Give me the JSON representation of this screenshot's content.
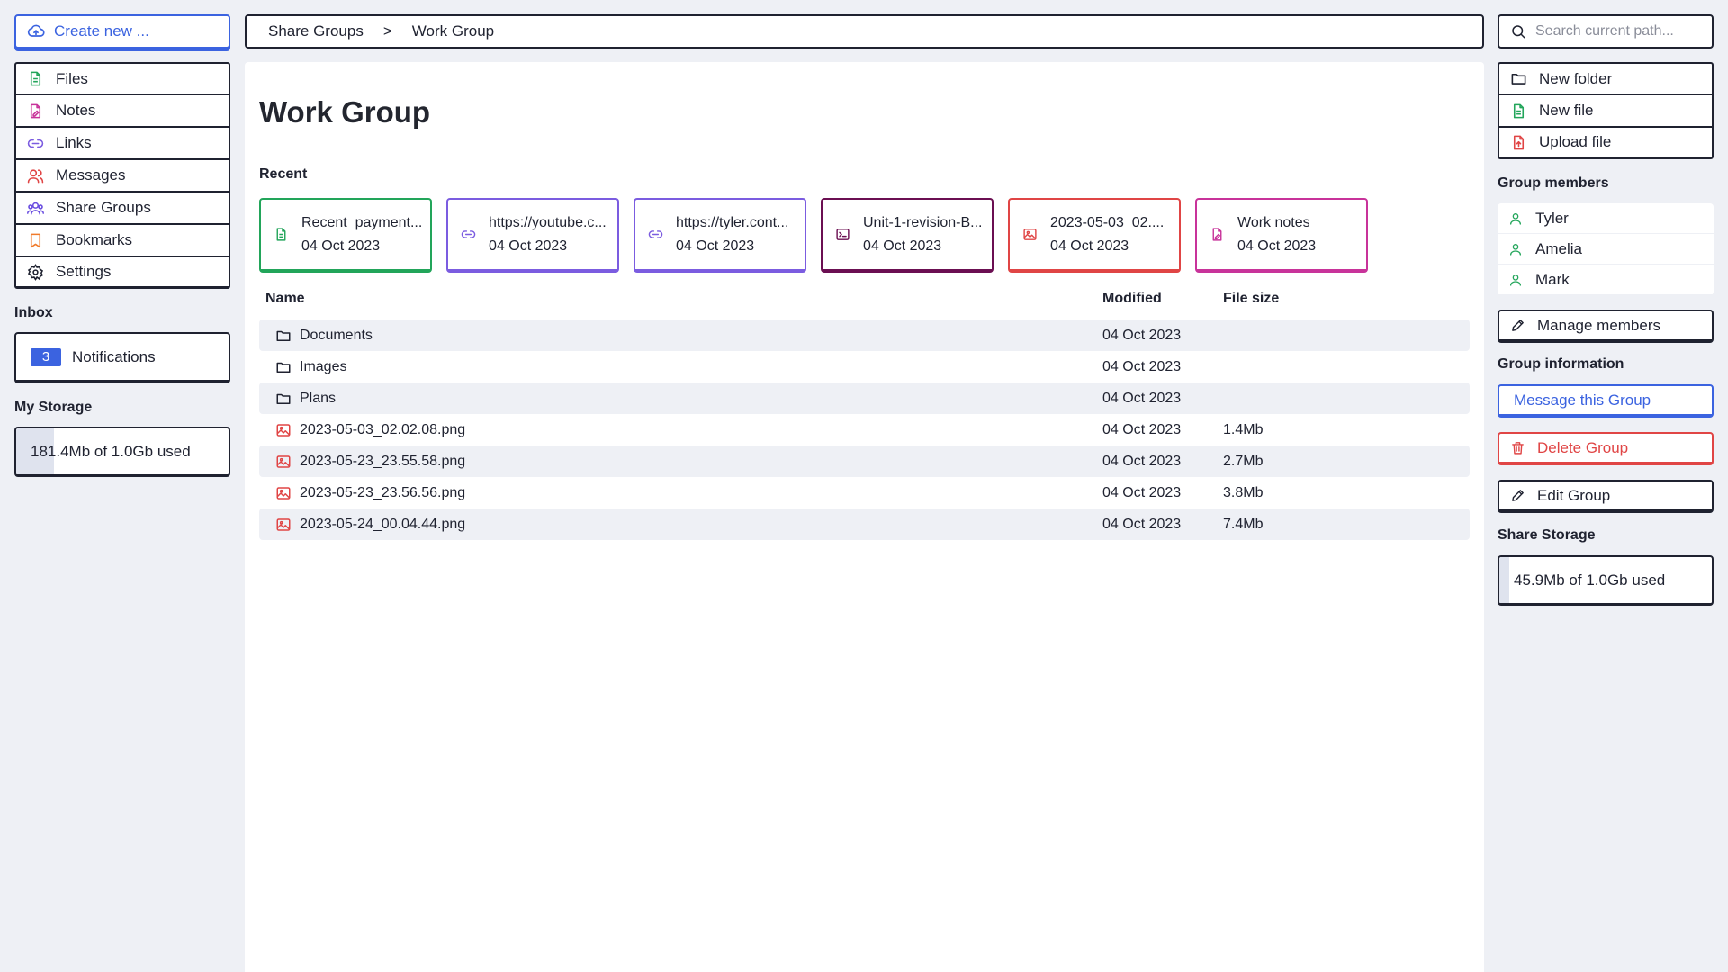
{
  "left": {
    "create_label": "Create new ...",
    "nav": [
      {
        "label": "Files",
        "icon": "file-icon",
        "color": "#22a55a"
      },
      {
        "label": "Notes",
        "icon": "note-icon",
        "color": "#c8339a"
      },
      {
        "label": "Links",
        "icon": "link-icon",
        "color": "#7b5ce0"
      },
      {
        "label": "Messages",
        "icon": "users-icon",
        "color": "#e04545"
      },
      {
        "label": "Share Groups",
        "icon": "group-icon",
        "color": "#6a4ee0"
      },
      {
        "label": "Bookmarks",
        "icon": "bookmark-icon",
        "color": "#f07a2a"
      },
      {
        "label": "Settings",
        "icon": "gear-icon",
        "color": "#1f2230"
      }
    ],
    "inbox_title": "Inbox",
    "notifications_count": "3",
    "notifications_label": "Notifications",
    "storage_title": "My Storage",
    "storage_text": "181.4Mb of 1.0Gb used",
    "storage_fraction": 0.177
  },
  "breadcrumb": {
    "parent": "Share Groups",
    "separator": ">",
    "current": "Work Group"
  },
  "main": {
    "title": "Work Group",
    "recent_label": "Recent",
    "recent": [
      {
        "name": "Recent_payment...",
        "date": "04 Oct 2023",
        "icon": "file-icon",
        "color": "#22a55a"
      },
      {
        "name": "https://youtube.c...",
        "date": "04 Oct 2023",
        "icon": "link-icon",
        "color": "#7b5ce0"
      },
      {
        "name": "https://tyler.cont...",
        "date": "04 Oct 2023",
        "icon": "link-icon",
        "color": "#7b5ce0"
      },
      {
        "name": "Unit-1-revision-B...",
        "date": "04 Oct 2023",
        "icon": "terminal-icon",
        "color": "#6b0f52"
      },
      {
        "name": "2023-05-03_02....",
        "date": "04 Oct 2023",
        "icon": "image-icon",
        "color": "#e04545"
      },
      {
        "name": "Work notes",
        "date": "04 Oct 2023",
        "icon": "note-icon",
        "color": "#c8339a"
      }
    ],
    "columns": {
      "name": "Name",
      "modified": "Modified",
      "size": "File size"
    },
    "rows": [
      {
        "name": "Documents",
        "modified": "04 Oct 2023",
        "size": "",
        "icon": "folder-icon"
      },
      {
        "name": "Images",
        "modified": "04 Oct 2023",
        "size": "",
        "icon": "folder-icon"
      },
      {
        "name": "Plans",
        "modified": "04 Oct 2023",
        "size": "",
        "icon": "folder-icon"
      },
      {
        "name": "2023-05-03_02.02.08.png",
        "modified": "04 Oct 2023",
        "size": "1.4Mb",
        "icon": "image-icon"
      },
      {
        "name": "2023-05-23_23.55.58.png",
        "modified": "04 Oct 2023",
        "size": "2.7Mb",
        "icon": "image-icon"
      },
      {
        "name": "2023-05-23_23.56.56.png",
        "modified": "04 Oct 2023",
        "size": "3.8Mb",
        "icon": "image-icon"
      },
      {
        "name": "2023-05-24_00.04.44.png",
        "modified": "04 Oct 2023",
        "size": "7.4Mb",
        "icon": "image-icon"
      }
    ]
  },
  "right": {
    "search_placeholder": "Search current path...",
    "actions": [
      {
        "label": "New folder",
        "icon": "folder-icon"
      },
      {
        "label": "New file",
        "icon": "file-icon"
      },
      {
        "label": "Upload file",
        "icon": "upload-icon"
      }
    ],
    "members_title": "Group members",
    "members": [
      "Tyler",
      "Amelia",
      "Mark"
    ],
    "manage_label": "Manage members",
    "info_title": "Group information",
    "message_label": "Message this Group",
    "delete_label": "Delete Group",
    "edit_label": "Edit Group",
    "share_storage_title": "Share Storage",
    "share_storage_text": "45.9Mb of 1.0Gb used",
    "share_storage_fraction": 0.045
  },
  "colors": {
    "accent": "#3b63e0",
    "danger": "#e04545",
    "member": "#22a55a"
  }
}
